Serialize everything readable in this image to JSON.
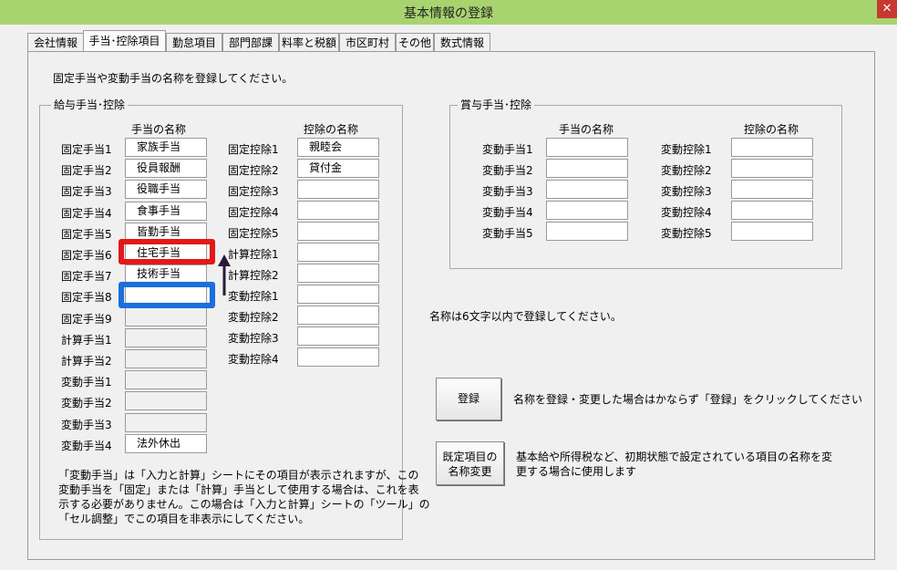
{
  "window": {
    "title": "基本情報の登録",
    "close_symbol": "✕"
  },
  "tabs": [
    "会社情報",
    "手当･控除項目",
    "勤怠項目",
    "部門部課",
    "料率と税額",
    "市区町村",
    "その他",
    "数式情報"
  ],
  "intro": "固定手当や変動手当の名称を登録してください。",
  "salary_group": {
    "title": "給与手当･控除",
    "allowance_header": "手当の名称",
    "deduction_header": "控除の名称",
    "allowances": [
      {
        "label": "固定手当1",
        "value": "家族手当"
      },
      {
        "label": "固定手当2",
        "value": "役員報酬"
      },
      {
        "label": "固定手当3",
        "value": "役職手当"
      },
      {
        "label": "固定手当4",
        "value": "食事手当"
      },
      {
        "label": "固定手当5",
        "value": "皆勤手当"
      },
      {
        "label": "固定手当6",
        "value": "住宅手当"
      },
      {
        "label": "固定手当7",
        "value": "技術手当"
      },
      {
        "label": "固定手当8",
        "value": ""
      },
      {
        "label": "固定手当9",
        "value": ""
      },
      {
        "label": "計算手当1",
        "value": ""
      },
      {
        "label": "計算手当2",
        "value": ""
      },
      {
        "label": "変動手当1",
        "value": ""
      },
      {
        "label": "変動手当2",
        "value": ""
      },
      {
        "label": "変動手当3",
        "value": ""
      },
      {
        "label": "変動手当4",
        "value": "法外休出"
      }
    ],
    "deductions": [
      {
        "label": "固定控除1",
        "value": "親睦会"
      },
      {
        "label": "固定控除2",
        "value": "貸付金"
      },
      {
        "label": "固定控除3",
        "value": ""
      },
      {
        "label": "固定控除4",
        "value": ""
      },
      {
        "label": "固定控除5",
        "value": ""
      },
      {
        "label": "計算控除1",
        "value": ""
      },
      {
        "label": "計算控除2",
        "value": ""
      },
      {
        "label": "変動控除1",
        "value": ""
      },
      {
        "label": "変動控除2",
        "value": ""
      },
      {
        "label": "変動控除3",
        "value": ""
      },
      {
        "label": "変動控除4",
        "value": ""
      }
    ],
    "note_lines": [
      "「変動手当」は「入力と計算」シートにその項目が表示されますが、この",
      "変動手当を「固定」または「計算」手当として使用する場合は、これを表",
      "示する必要がありません。この場合は「入力と計算」シートの「ツール」の",
      "「セル調整」でこの項目を非表示にしてください。"
    ]
  },
  "bonus_group": {
    "title": "賞与手当･控除",
    "allowance_header": "手当の名称",
    "deduction_header": "控除の名称",
    "allowances": [
      {
        "label": "変動手当1",
        "value": ""
      },
      {
        "label": "変動手当2",
        "value": ""
      },
      {
        "label": "変動手当3",
        "value": ""
      },
      {
        "label": "変動手当4",
        "value": ""
      },
      {
        "label": "変動手当5",
        "value": ""
      }
    ],
    "deductions": [
      {
        "label": "変動控除1",
        "value": ""
      },
      {
        "label": "変動控除2",
        "value": ""
      },
      {
        "label": "変動控除3",
        "value": ""
      },
      {
        "label": "変動控除4",
        "value": ""
      },
      {
        "label": "変動控除5",
        "value": ""
      }
    ]
  },
  "name_limit_note": "名称は6文字以内で登録してください。",
  "register_button": {
    "label": "登録",
    "description": "名称を登録・変更した場合はかならず「登録」をクリックしてください"
  },
  "rename_button": {
    "label_line1": "既定項目の",
    "label_line2": "名称変更",
    "description_line1": "基本給や所得税など、初期状態で設定されている項目の名称を変",
    "description_line2": "更する場合に使用します"
  },
  "colors": {
    "titlebar": "#a8d46f",
    "close": "#c7392e",
    "highlight_red": "#e41818",
    "highlight_blue": "#1a6fdc"
  }
}
